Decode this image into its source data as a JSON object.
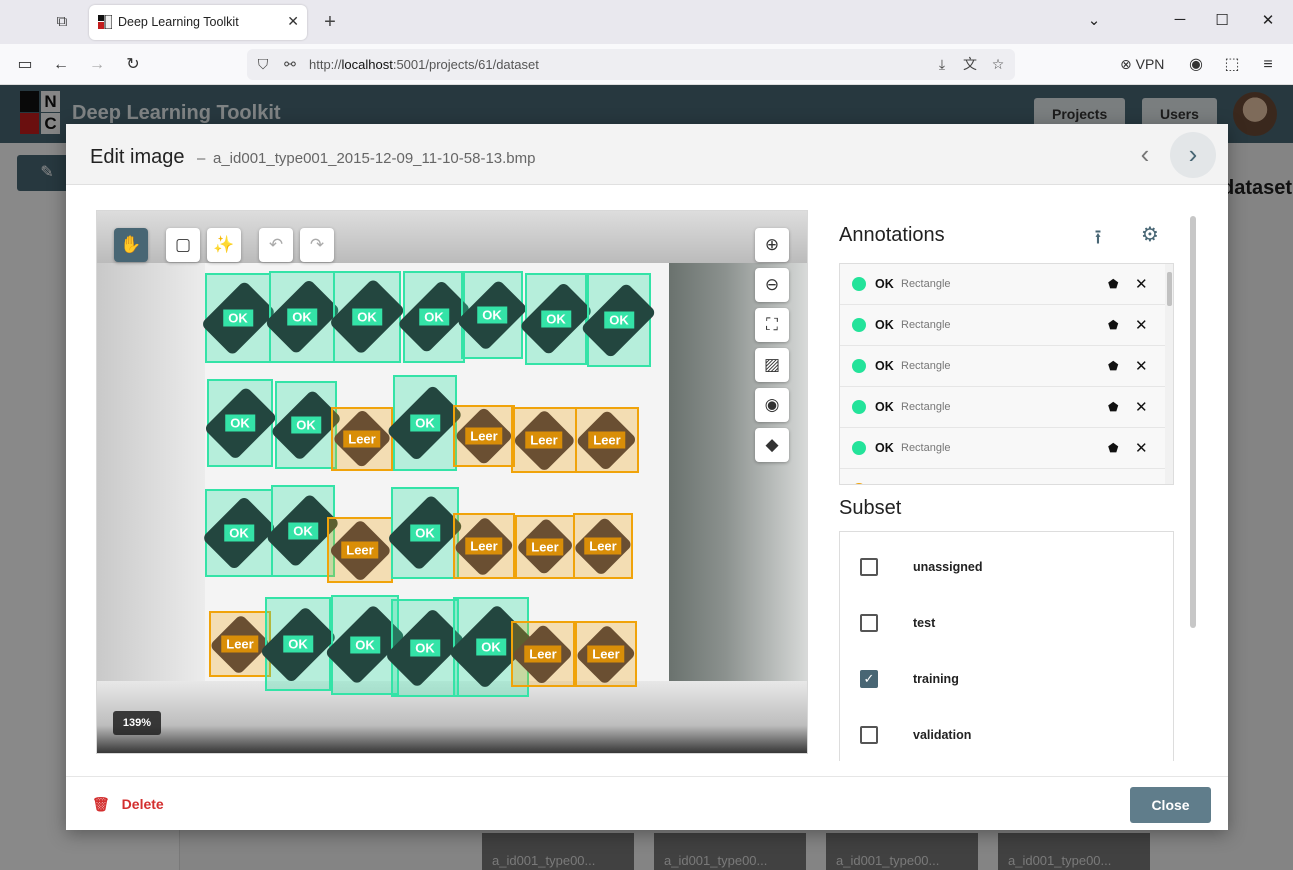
{
  "browser": {
    "tab_title": "Deep Learning Toolkit",
    "url_prefix": "http://",
    "url_host": "localhost",
    "url_path": ":5001/projects/61/dataset",
    "vpn_label": "VPN"
  },
  "app": {
    "title": "Deep Learning Toolkit",
    "nav": [
      "Projects",
      "Users"
    ],
    "bg_title_fragment": "dataset",
    "thumb_label": "a_id001_type00..."
  },
  "modal": {
    "title": "Edit image",
    "separator": "–",
    "filename": "a_id001_type001_2015-12-09_11-10-58-13.bmp",
    "zoom": "139%",
    "delete_label": "Delete",
    "close_label": "Close"
  },
  "annotations": {
    "title": "Annotations",
    "rows": [
      {
        "label": "OK",
        "type": "Rectangle",
        "color": "#23e39a"
      },
      {
        "label": "OK",
        "type": "Rectangle",
        "color": "#23e39a"
      },
      {
        "label": "OK",
        "type": "Rectangle",
        "color": "#23e39a"
      },
      {
        "label": "OK",
        "type": "Rectangle",
        "color": "#23e39a"
      },
      {
        "label": "OK",
        "type": "Rectangle",
        "color": "#23e39a"
      }
    ]
  },
  "subset": {
    "title": "Subset",
    "options": [
      {
        "label": "unassigned",
        "checked": false
      },
      {
        "label": "test",
        "checked": false
      },
      {
        "label": "training",
        "checked": true
      },
      {
        "label": "validation",
        "checked": false
      }
    ]
  },
  "canvas_labels": {
    "ok": "OK",
    "leer": "Leer"
  },
  "colors": {
    "ok": "#34e3a7",
    "leer": "#f0a30a",
    "accent": "#486674",
    "delete": "#d32f2f"
  }
}
